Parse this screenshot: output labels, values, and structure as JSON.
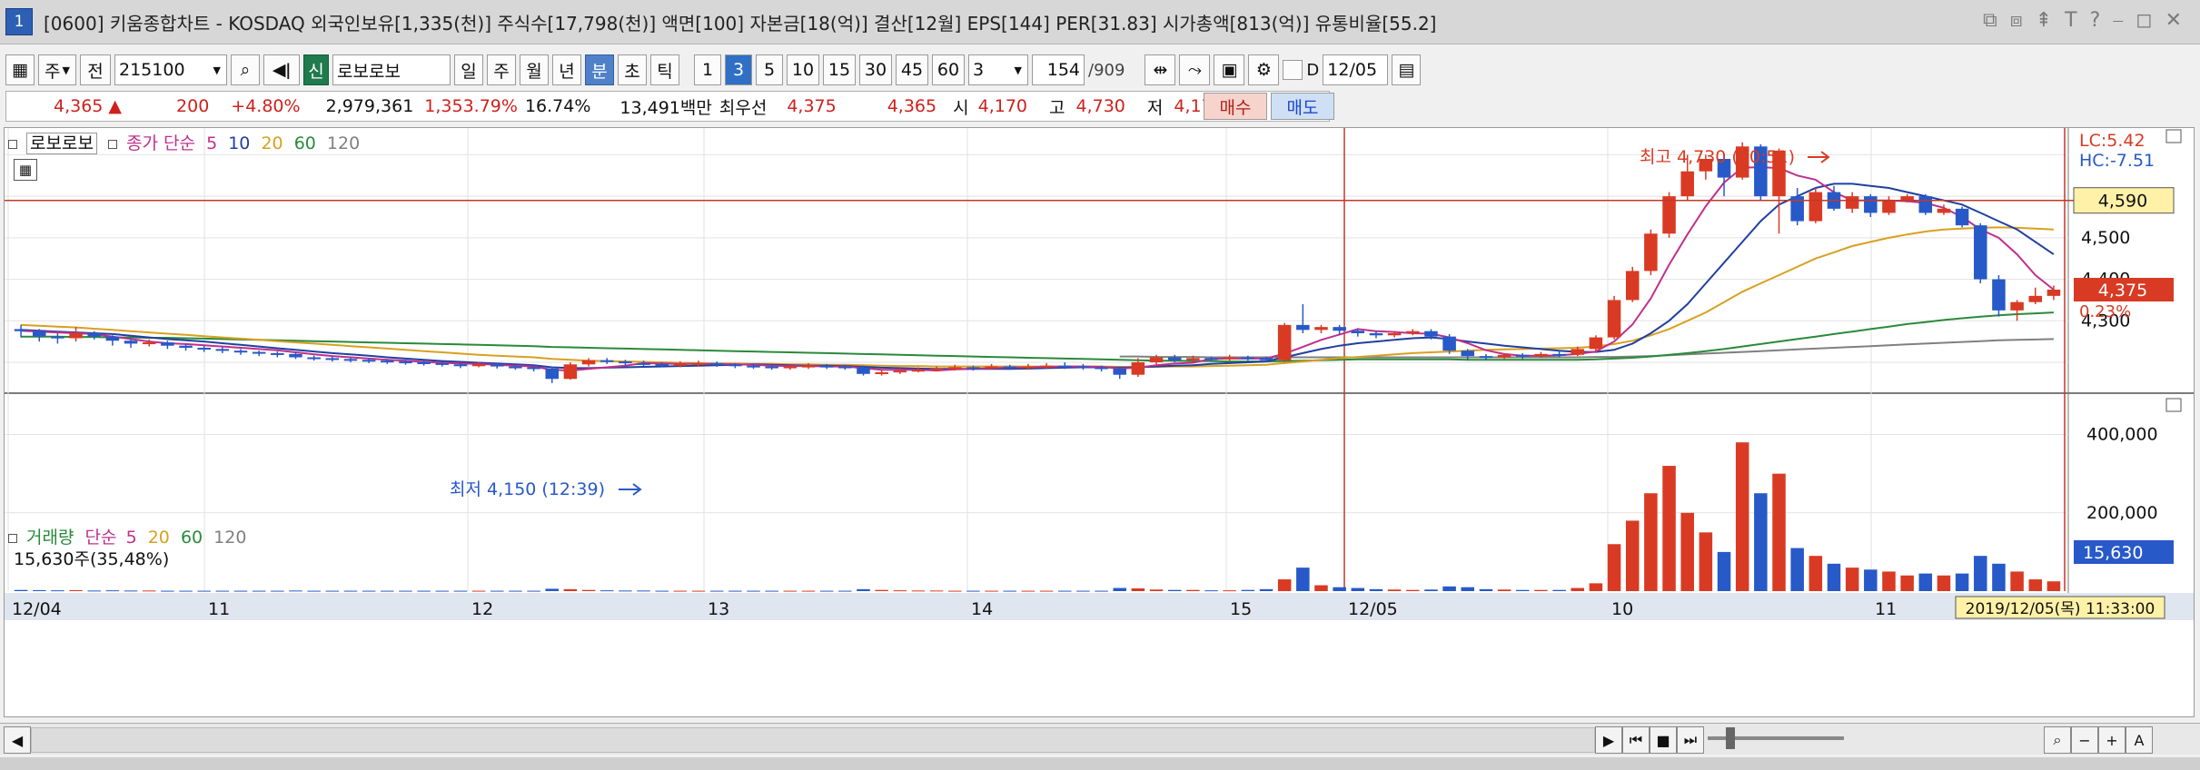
{
  "window": {
    "number": "1",
    "title": "[0600] 키움종합차트 - KOSDAQ 외국인보유[1,335(천)] 주식수[17,798(천)] 액면[100] 자본금[18(억)] 결산[12월] EPS[144] PER[31.83] 시가총액[813(억)] 유통비율[55.2]",
    "controls": [
      "⧉",
      "⧈",
      "⇞",
      "T",
      "?",
      "⎯",
      "◻",
      "✕"
    ]
  },
  "toolbar": {
    "period_select": "주",
    "prev_label": "전",
    "code": "215100",
    "new_label": "신",
    "stock_name": "로보로보",
    "period_buttons": [
      "일",
      "주",
      "월",
      "년",
      "분",
      "초",
      "틱"
    ],
    "interval_buttons": [
      "1",
      "3",
      "5",
      "10",
      "15",
      "30",
      "45",
      "60"
    ],
    "interval_value": "3",
    "count_value": "154",
    "count_total": "/909",
    "date_checkbox_label": "D",
    "date_value": "12/05"
  },
  "quote": {
    "price": "4,365",
    "arrow": "▲",
    "change": "200",
    "change_pct": "+4.80%",
    "volume": "2,979,361",
    "volume_ratio": "1,353.79%",
    "turnover": "16.74%",
    "amount": "13,491백만",
    "best_bid_label": "최우선",
    "best_ask": "4,375",
    "best_bid": "4,365",
    "open_label": "시",
    "open": "4,170",
    "high_label": "고",
    "high": "4,730",
    "low_label": "저",
    "low": "4,170",
    "buy_button": "매수",
    "sell_button": "매도"
  },
  "price_legend": {
    "name": "로보로보",
    "ma_label": "종가 단순",
    "ma_periods": [
      "5",
      "10",
      "20",
      "60",
      "120"
    ]
  },
  "volume_legend": {
    "name": "거래량",
    "ma_label": "단순",
    "ma_periods": [
      "5",
      "20",
      "60",
      "120"
    ],
    "current": "15,630주(35,48%)"
  },
  "annotations": {
    "high": "최고 4,730 (10:51)",
    "low": "최저 4,150 (12:39)",
    "lc": "LC:5.42",
    "hc": "HC:-7.51",
    "cursor_price": "4,590",
    "last_price": "4,375",
    "last_pct": "0.23%",
    "volume_value": "15,630",
    "volume_pct": "35.48%",
    "timestamp": "2019/12/05(목) 11:33:00"
  },
  "colors": {
    "up": "#d93a23",
    "down": "#2859c8",
    "ma5": "#c0308c",
    "ma10": "#2040a0",
    "ma20": "#d8a020",
    "ma60": "#2a8a3a",
    "ma120": "#808080"
  },
  "chart_data": {
    "type": "candlestick",
    "price_axis": {
      "ticks": [
        4200,
        4300,
        4400,
        4500,
        4600,
        4700
      ],
      "range": [
        4130,
        4760
      ]
    },
    "volume_axis": {
      "ticks": [
        200000,
        400000
      ],
      "tick_labels": [
        "200,000",
        "400,000"
      ],
      "range": [
        0,
        450000
      ]
    },
    "x_labels": [
      "12/04",
      "11",
      "12",
      "13",
      "14",
      "15",
      "12/05",
      "10",
      "11"
    ],
    "candles": [
      [
        4280,
        4275,
        4260,
        4290
      ],
      [
        4275,
        4262,
        4250,
        4280
      ],
      [
        4262,
        4258,
        4245,
        4270
      ],
      [
        4258,
        4270,
        4250,
        4285
      ],
      [
        4270,
        4262,
        4255,
        4275
      ],
      [
        4262,
        4252,
        4240,
        4265
      ],
      [
        4252,
        4245,
        4235,
        4258
      ],
      [
        4245,
        4248,
        4238,
        4255
      ],
      [
        4248,
        4240,
        4232,
        4252
      ],
      [
        4240,
        4235,
        4228,
        4245
      ],
      [
        4235,
        4232,
        4225,
        4240
      ],
      [
        4232,
        4228,
        4222,
        4236
      ],
      [
        4228,
        4225,
        4218,
        4232
      ],
      [
        4225,
        4222,
        4215,
        4228
      ],
      [
        4222,
        4220,
        4212,
        4226
      ],
      [
        4220,
        4212,
        4208,
        4224
      ],
      [
        4212,
        4210,
        4204,
        4216
      ],
      [
        4210,
        4208,
        4202,
        4214
      ],
      [
        4208,
        4206,
        4200,
        4212
      ],
      [
        4206,
        4204,
        4198,
        4210
      ],
      [
        4204,
        4202,
        4196,
        4208
      ],
      [
        4202,
        4200,
        4194,
        4206
      ],
      [
        4200,
        4198,
        4192,
        4204
      ],
      [
        4198,
        4195,
        4190,
        4202
      ],
      [
        4195,
        4192,
        4186,
        4198
      ],
      [
        4192,
        4195,
        4188,
        4200
      ],
      [
        4195,
        4190,
        4185,
        4198
      ],
      [
        4190,
        4188,
        4182,
        4194
      ],
      [
        4188,
        4185,
        4178,
        4192
      ],
      [
        4185,
        4160,
        4150,
        4190
      ],
      [
        4160,
        4195,
        4158,
        4200
      ],
      [
        4195,
        4205,
        4190,
        4210
      ],
      [
        4205,
        4202,
        4196,
        4210
      ],
      [
        4202,
        4198,
        4192,
        4206
      ],
      [
        4198,
        4196,
        4190,
        4204
      ],
      [
        4196,
        4194,
        4188,
        4200
      ],
      [
        4194,
        4196,
        4188,
        4202
      ],
      [
        4196,
        4198,
        4190,
        4204
      ],
      [
        4198,
        4195,
        4189,
        4202
      ],
      [
        4195,
        4192,
        4186,
        4198
      ],
      [
        4192,
        4190,
        4184,
        4196
      ],
      [
        4190,
        4188,
        4182,
        4194
      ],
      [
        4188,
        4190,
        4182,
        4196
      ],
      [
        4190,
        4192,
        4184,
        4198
      ],
      [
        4192,
        4190,
        4184,
        4196
      ],
      [
        4190,
        4188,
        4182,
        4194
      ],
      [
        4188,
        4172,
        4168,
        4192
      ],
      [
        4172,
        4176,
        4168,
        4182
      ],
      [
        4176,
        4180,
        4172,
        4186
      ],
      [
        4180,
        4182,
        4176,
        4188
      ],
      [
        4182,
        4185,
        4178,
        4190
      ],
      [
        4185,
        4188,
        4180,
        4194
      ],
      [
        4188,
        4186,
        4180,
        4192
      ],
      [
        4186,
        4190,
        4182,
        4196
      ],
      [
        4190,
        4188,
        4182,
        4194
      ],
      [
        4188,
        4190,
        4182,
        4196
      ],
      [
        4190,
        4192,
        4184,
        4198
      ],
      [
        4192,
        4190,
        4184,
        4200
      ],
      [
        4190,
        4188,
        4182,
        4196
      ],
      [
        4188,
        4185,
        4178,
        4192
      ],
      [
        4185,
        4170,
        4160,
        4190
      ],
      [
        4170,
        4200,
        4165,
        4210
      ],
      [
        4200,
        4212,
        4195,
        4218
      ],
      [
        4212,
        4205,
        4200,
        4218
      ],
      [
        4205,
        4210,
        4200,
        4216
      ],
      [
        4210,
        4208,
        4202,
        4214
      ],
      [
        4208,
        4212,
        4204,
        4218
      ],
      [
        4212,
        4210,
        4204,
        4216
      ],
      [
        4210,
        4205,
        4200,
        4214
      ],
      [
        4205,
        4290,
        4200,
        4295
      ],
      [
        4290,
        4278,
        4270,
        4340
      ],
      [
        4278,
        4285,
        4270,
        4290
      ],
      [
        4285,
        4276,
        4268,
        4290
      ],
      [
        4276,
        4270,
        4262,
        4282
      ],
      [
        4270,
        4265,
        4258,
        4276
      ],
      [
        4265,
        4270,
        4260,
        4275
      ],
      [
        4270,
        4275,
        4265,
        4280
      ],
      [
        4275,
        4262,
        4255,
        4280
      ],
      [
        4262,
        4228,
        4220,
        4268
      ],
      [
        4228,
        4215,
        4205,
        4232
      ],
      [
        4215,
        4212,
        4205,
        4220
      ],
      [
        4212,
        4218,
        4208,
        4222
      ],
      [
        4218,
        4215,
        4208,
        4222
      ],
      [
        4215,
        4220,
        4210,
        4225
      ],
      [
        4220,
        4218,
        4212,
        4228
      ],
      [
        4218,
        4232,
        4215,
        4238
      ],
      [
        4232,
        4260,
        4225,
        4265
      ],
      [
        4260,
        4350,
        4255,
        4360
      ],
      [
        4350,
        4420,
        4345,
        4430
      ],
      [
        4420,
        4510,
        4410,
        4520
      ],
      [
        4510,
        4600,
        4500,
        4610
      ],
      [
        4600,
        4660,
        4590,
        4700
      ],
      [
        4660,
        4690,
        4640,
        4700
      ],
      [
        4690,
        4645,
        4600,
        4700
      ],
      [
        4645,
        4720,
        4640,
        4730
      ],
      [
        4720,
        4600,
        4590,
        4725
      ],
      [
        4600,
        4710,
        4510,
        4715
      ],
      [
        4600,
        4540,
        4530,
        4620
      ],
      [
        4540,
        4610,
        4535,
        4620
      ],
      [
        4610,
        4570,
        4565,
        4625
      ],
      [
        4570,
        4600,
        4560,
        4610
      ],
      [
        4600,
        4560,
        4550,
        4605
      ],
      [
        4560,
        4590,
        4555,
        4600
      ],
      [
        4590,
        4600,
        4585,
        4605
      ],
      [
        4600,
        4560,
        4555,
        4605
      ],
      [
        4560,
        4570,
        4555,
        4580
      ],
      [
        4570,
        4530,
        4525,
        4575
      ],
      [
        4530,
        4400,
        4390,
        4535
      ],
      [
        4400,
        4325,
        4310,
        4410
      ],
      [
        4325,
        4345,
        4300,
        4350
      ],
      [
        4345,
        4360,
        4340,
        4380
      ],
      [
        4360,
        4375,
        4350,
        4385
      ]
    ],
    "volumes": [
      3000,
      2500,
      2000,
      2500,
      1500,
      2000,
      1500,
      1500,
      1000,
      1000,
      1000,
      1000,
      1000,
      1000,
      1000,
      1500,
      1000,
      1000,
      1000,
      1000,
      1000,
      1000,
      1000,
      1000,
      1000,
      1000,
      1000,
      1000,
      1000,
      6000,
      5000,
      3000,
      2000,
      1500,
      1500,
      1000,
      1000,
      1000,
      1000,
      1000,
      1000,
      1000,
      1000,
      1000,
      1000,
      1000,
      5000,
      3000,
      2000,
      1500,
      1500,
      1000,
      1000,
      1000,
      1000,
      1000,
      1000,
      1000,
      1000,
      1000,
      8000,
      7000,
      4000,
      3000,
      3000,
      2000,
      2000,
      3000,
      5000,
      30000,
      60000,
      15000,
      10000,
      8000,
      5000,
      4000,
      3000,
      4000,
      12000,
      10000,
      5000,
      4000,
      3000,
      3000,
      3000,
      8000,
      20000,
      120000,
      180000,
      250000,
      320000,
      200000,
      150000,
      100000,
      380000,
      250000,
      300000,
      110000,
      90000,
      70000,
      60000,
      55000,
      50000,
      40000,
      45000,
      40000,
      45000,
      90000,
      70000,
      50000,
      30000,
      25000
    ],
    "ma5": [
      4276,
      4274,
      4272,
      4270,
      4268,
      4262,
      4256,
      4250,
      4246,
      4244,
      4241,
      4238,
      4235,
      4232,
      4229,
      4224,
      4219,
      4215,
      4212,
      4209,
      4206,
      4204,
      4201,
      4199,
      4197,
      4196,
      4194,
      4192,
      4190,
      4182,
      4180,
      4184,
      4188,
      4192,
      4198,
      4197,
      4196,
      4196,
      4196,
      4195,
      4194,
      4192,
      4191,
      4191,
      4190,
      4190,
      4186,
      4182,
      4182,
      4182,
      4180,
      4183,
      4184,
      4186,
      4187,
      4188,
      4189,
      4190,
      4190,
      4189,
      4185,
      4187,
      4193,
      4197,
      4199,
      4208,
      4209,
      4209,
      4209,
      4221,
      4237,
      4254,
      4267,
      4280,
      4275,
      4273,
      4270,
      4269,
      4260,
      4246,
      4229,
      4220,
      4216,
      4216,
      4217,
      4220,
      4226,
      4250,
      4291,
      4354,
      4435,
      4508,
      4576,
      4633,
      4669,
      4670,
      4668,
      4650,
      4640,
      4610,
      4590,
      4590,
      4590,
      4588,
      4584,
      4572,
      4550,
      4520,
      4500,
      4460,
      4410,
      4375
    ],
    "ma10": [
      4278,
      4276,
      4274,
      4272,
      4270,
      4268,
      4264,
      4260,
      4256,
      4253,
      4250,
      4246,
      4242,
      4238,
      4234,
      4230,
      4226,
      4222,
      4219,
      4216,
      4212,
      4209,
      4206,
      4203,
      4201,
      4199,
      4197,
      4195,
      4193,
      4188,
      4186,
      4186,
      4187,
      4188,
      4189,
      4190,
      4191,
      4192,
      4193,
      4194,
      4195,
      4194,
      4193,
      4192,
      4192,
      4191,
      4189,
      4187,
      4186,
      4185,
      4184,
      4184,
      4184,
      4184,
      4184,
      4185,
      4186,
      4187,
      4188,
      4188,
      4187,
      4188,
      4190,
      4192,
      4193,
      4196,
      4198,
      4200,
      4202,
      4212,
      4222,
      4232,
      4240,
      4246,
      4250,
      4254,
      4258,
      4260,
      4256,
      4250,
      4245,
      4240,
      4236,
      4232,
      4228,
      4225,
      4225,
      4230,
      4245,
      4270,
      4300,
      4340,
      4390,
      4440,
      4490,
      4540,
      4580,
      4600,
      4620,
      4630,
      4630,
      4625,
      4620,
      4610,
      4600,
      4590,
      4580,
      4560,
      4540,
      4520,
      4490,
      4460
    ],
    "ma20": [
      4290,
      4288,
      4286,
      4284,
      4281,
      4278,
      4275,
      4272,
      4269,
      4266,
      4263,
      4260,
      4257,
      4254,
      4251,
      4248,
      4245,
      4242,
      4239,
      4236,
      4233,
      4230,
      4227,
      4224,
      4221,
      4218,
      4216,
      4214,
      4212,
      4208,
      4206,
      4204,
      4203,
      4202,
      4201,
      4200,
      4199,
      4198,
      4197,
      4197,
      4196,
      4196,
      4195,
      4195,
      4194,
      4194,
      4193,
      4192,
      4191,
      4191,
      4190,
      4190,
      4190,
      4190,
      4190,
      4190,
      4190,
      4190,
      4190,
      4190,
      4189,
      4189,
      4189,
      4190,
      4190,
      4191,
      4192,
      4193,
      4194,
      4198,
      4202,
      4206,
      4210,
      4213,
      4216,
      4219,
      4222,
      4224,
      4226,
      4228,
      4230,
      4231,
      4232,
      4233,
      4234,
      4235,
      4238,
      4244,
      4252,
      4265,
      4280,
      4300,
      4320,
      4345,
      4370,
      4390,
      4410,
      4430,
      4450,
      4465,
      4480,
      4490,
      4500,
      4508,
      4515,
      4520,
      4522,
      4524,
      4525,
      4524,
      4522,
      4520
    ],
    "ma60": [
      4262,
      4262,
      4262,
      4261,
      4261,
      4260,
      4260,
      4259,
      4259,
      4258,
      4257,
      4256,
      4255,
      4254,
      4253,
      4252,
      4251,
      4250,
      4249,
      4248,
      4247,
      4246,
      4245,
      4244,
      4243,
      4242,
      4241,
      4240,
      4239,
      4237,
      4236,
      4235,
      4234,
      4233,
      4232,
      4231,
      4230,
      4229,
      4228,
      4227,
      4226,
      4225,
      4224,
      4223,
      4222,
      4221,
      4220,
      4219,
      4218,
      4217,
      4216,
      4215,
      4214,
      4213,
      4212,
      4211,
      4210,
      4209,
      4208,
      4207,
      4206,
      4205,
      4204,
      4204,
      4203,
      4203,
      4202,
      4202,
      4202,
      4203,
      4204,
      4205,
      4206,
      4207,
      4207,
      4207,
      4207,
      4207,
      4207,
      4206,
      4206,
      4206,
      4206,
      4206,
      4206,
      4206,
      4207,
      4209,
      4211,
      4214,
      4218,
      4222,
      4227,
      4232,
      4238,
      4244,
      4250,
      4256,
      4262,
      4268,
      4274,
      4280,
      4286,
      4292,
      4297,
      4302,
      4306,
      4310,
      4313,
      4316,
      4318,
      4320
    ],
    "ma120": [
      null,
      null,
      null,
      null,
      null,
      null,
      null,
      null,
      null,
      null,
      null,
      null,
      null,
      null,
      null,
      null,
      null,
      null,
      null,
      null,
      null,
      null,
      null,
      null,
      null,
      null,
      null,
      null,
      null,
      null,
      null,
      null,
      null,
      null,
      null,
      null,
      null,
      null,
      null,
      null,
      null,
      null,
      null,
      null,
      null,
      null,
      null,
      null,
      null,
      null,
      null,
      null,
      null,
      null,
      null,
      null,
      null,
      null,
      null,
      null,
      4214,
      4214,
      4213,
      4213,
      4213,
      4212,
      4212,
      4212,
      4212,
      4212,
      4212,
      4212,
      4212,
      4212,
      4212,
      4212,
      4212,
      4212,
      4212,
      4212,
      4212,
      4212,
      4212,
      4212,
      4212,
      4212,
      4213,
      4213,
      4214,
      4215,
      4217,
      4219,
      4221,
      4223,
      4225,
      4227,
      4229,
      4231,
      4233,
      4235,
      4237,
      4239,
      4241,
      4243,
      4245,
      4247,
      4249,
      4251,
      4253,
      4254,
      4255,
      4256
    ]
  }
}
